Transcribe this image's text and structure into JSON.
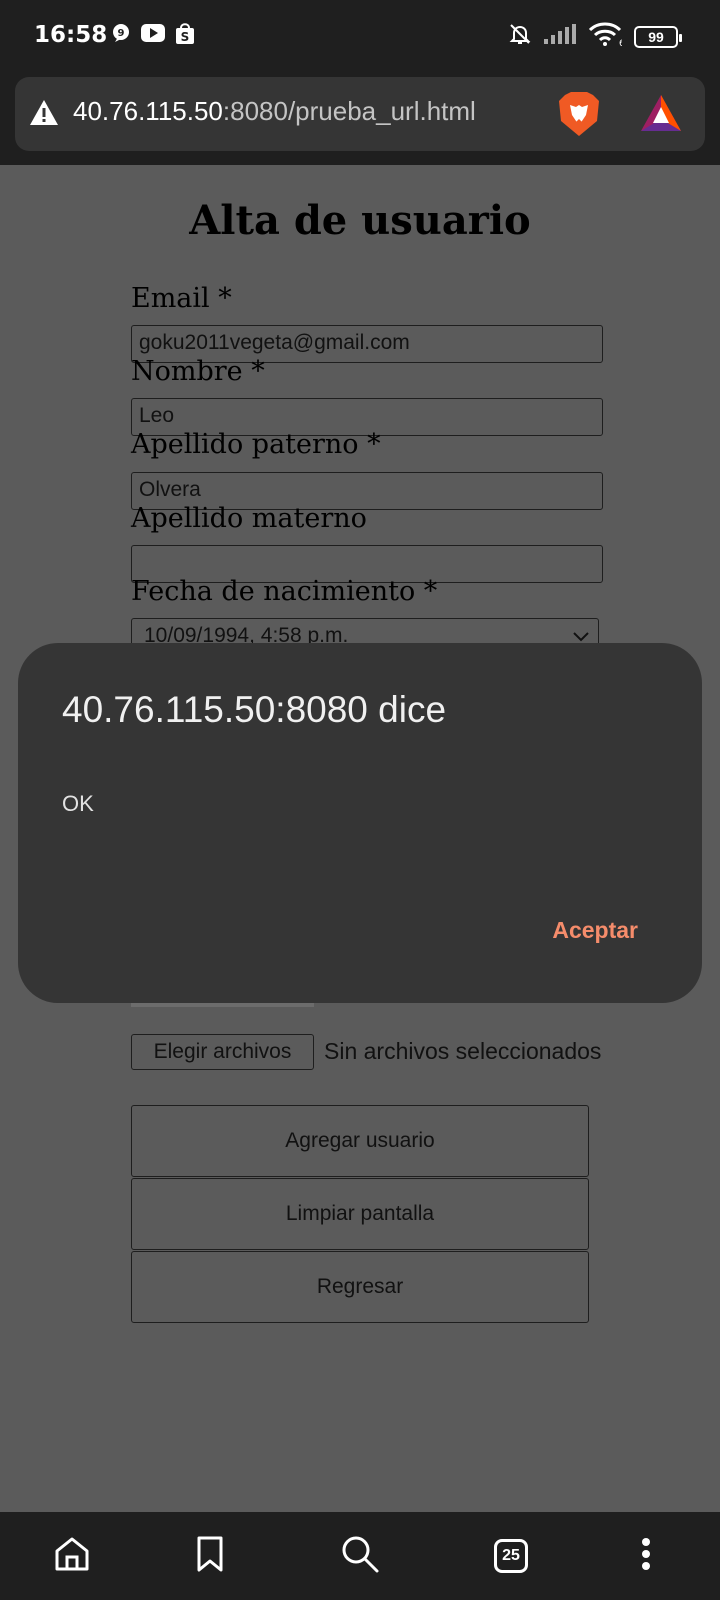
{
  "status_bar": {
    "time": "16:58",
    "left_icons": [
      "chat-icon",
      "youtube-icon",
      "shopping-bag-icon"
    ],
    "right_icons": [
      "bell-muted-icon",
      "signal-icon",
      "wifi-icon"
    ],
    "battery": "99",
    "wifi_label": "6"
  },
  "browser": {
    "url_host": "40.76.115.50",
    "url_rest": ":8080/prueba_url.html",
    "security_icon": "warning-icon",
    "brave_icon": "brave-lion-icon",
    "bat_icon": "bat-triangle-icon"
  },
  "form": {
    "title": "Alta de usuario",
    "email_label": "Email *",
    "email_value": "goku2011vegeta@gmail.com",
    "nombre_label": "Nombre *",
    "nombre_value": "Leo",
    "apellido_paterno_label": "Apellido paterno *",
    "apellido_paterno_value": "Olvera",
    "apellido_materno_label": "Apellido materno",
    "apellido_materno_value": "",
    "fecha_label": "Fecha de nacimiento *",
    "fecha_value": "10/09/1994, 4:58 p.m.",
    "file_button": "Elegir archivos",
    "file_status": "Sin archivos seleccionados",
    "buttons": {
      "agregar": "Agregar usuario",
      "limpiar": "Limpiar pantalla",
      "regresar": "Regresar"
    }
  },
  "dialog": {
    "title": "40.76.115.50:8080 dice",
    "message": "OK",
    "accept": "Aceptar",
    "accent_color": "#f58c6b"
  },
  "bottom_nav": {
    "items": [
      "home-icon",
      "bookmark-icon",
      "search-icon",
      "tabs-icon",
      "more-icon"
    ],
    "tabs_count": "25"
  },
  "colors": {
    "page_overlay": "#5b5b5b",
    "dialog_bg": "#353535",
    "chrome_bg": "#1f1f1f"
  }
}
